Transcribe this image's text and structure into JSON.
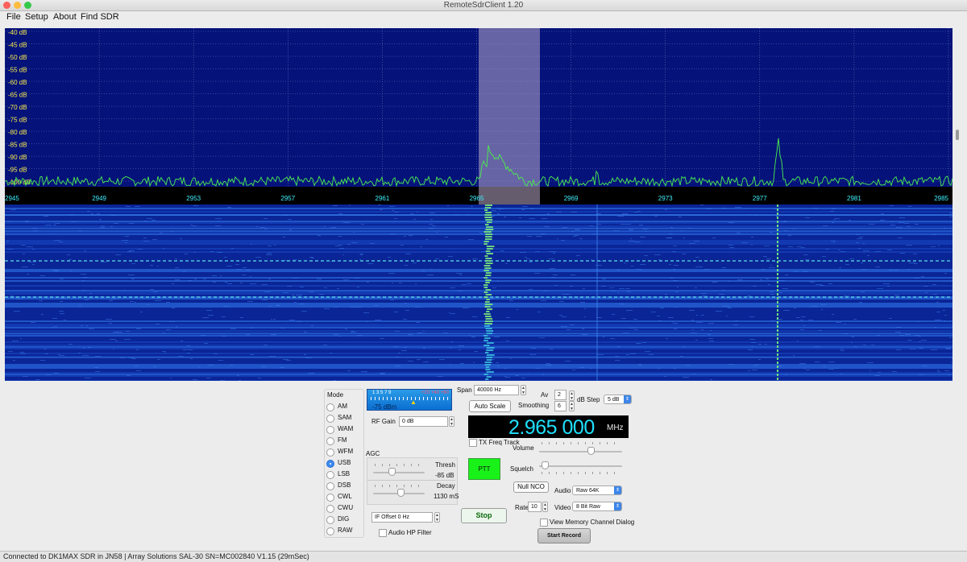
{
  "window": {
    "title": "RemoteSdrClient 1.20"
  },
  "menu": [
    "File",
    "Setup",
    "About",
    "Find SDR"
  ],
  "spectrum": {
    "db_labels": [
      "-40 dB",
      "-45 dB",
      "-50 dB",
      "-55 dB",
      "-60 dB",
      "-65 dB",
      "-70 dB",
      "-75 dB",
      "-80 dB",
      "-85 dB",
      "-90 dB",
      "-95 dB",
      "-100 dB"
    ],
    "freq_labels": [
      "2945",
      "2949",
      "2953",
      "2957",
      "2961",
      "2965",
      "2969",
      "2973",
      "2977",
      "2981",
      "2985"
    ],
    "trace_color": "#4cf04c",
    "background_color": "#04127a",
    "passband_color": "#b8a7c8"
  },
  "mode": {
    "title": "Mode",
    "options": [
      "AM",
      "SAM",
      "WAM",
      "FM",
      "WFM",
      "USB",
      "LSB",
      "DSB",
      "CWL",
      "CWU",
      "DIG",
      "RAW"
    ],
    "selected": "USB"
  },
  "smeter": {
    "scale": "1  3  5  7  9",
    "over": "+20 +40 +60",
    "value": "-75 dBm"
  },
  "rf_gain": {
    "label": "RF Gain",
    "value": "0 dB"
  },
  "agc": {
    "title": "AGC",
    "thresh_label": "Thresh",
    "thresh_value": "-85 dB",
    "decay_label": "Decay",
    "decay_value": "1130 mS"
  },
  "if_offset": {
    "value": "IF Offset 0 Hz"
  },
  "audio_hp": {
    "label": "Audio HP Filter"
  },
  "span": {
    "label": "Span",
    "value": "40000 Hz"
  },
  "auto_scale": {
    "label": "Auto Scale"
  },
  "av": {
    "label": "Av",
    "value": "2"
  },
  "smoothing": {
    "label": "Smoothing",
    "value": "6"
  },
  "db_step": {
    "label": "dB Step",
    "value": "5 dB"
  },
  "frequency": {
    "value": "2.965 000",
    "unit": "MHz"
  },
  "tx_freq_track": {
    "label": "TX Freq Track"
  },
  "volume": {
    "label": "Volume",
    "level": 0.62
  },
  "squelch": {
    "label": "Squelch",
    "level": 0.03
  },
  "ptt": {
    "label": "PTT"
  },
  "null_nco": {
    "label": "Null NCO"
  },
  "audio": {
    "label": "Audio",
    "value": "Raw 64K"
  },
  "rate": {
    "label": "Rate",
    "value": "10"
  },
  "video": {
    "label": "Video",
    "value": "8 Bit Raw"
  },
  "stop": {
    "label": "Stop"
  },
  "memory_dialog": {
    "label": "View Memory Channel Dialog"
  },
  "start_record": {
    "label": "Start Record"
  },
  "status": {
    "text": "Connected to DK1MAX SDR in JN58 | Array Solutions SAL-30 SN=MC002840 V1.15 (29mSec)"
  }
}
